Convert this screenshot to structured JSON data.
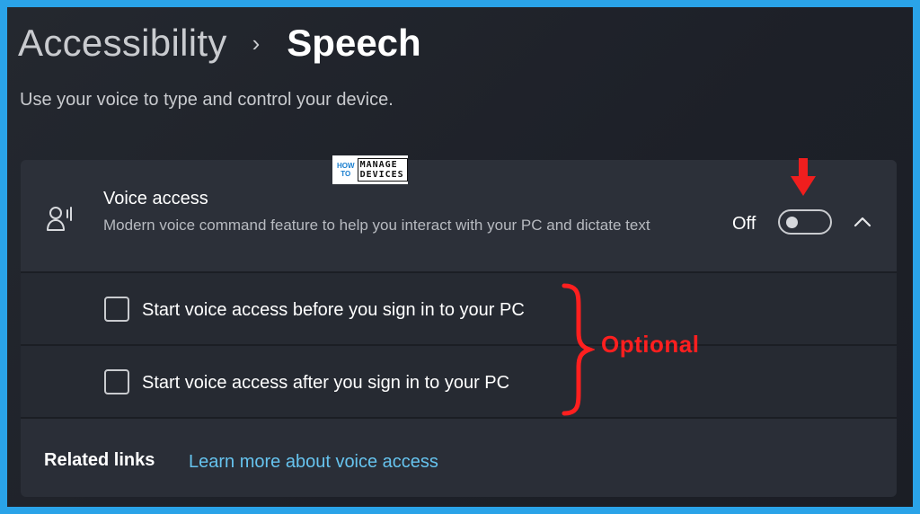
{
  "breadcrumb": {
    "parent": "Accessibility",
    "separator": "›",
    "current": "Speech"
  },
  "subtitle": "Use your voice to type and control your device.",
  "voice_access": {
    "icon": "voice-access-icon",
    "title": "Voice access",
    "description": "Modern voice command feature to help you interact with your PC and dictate text",
    "toggle_state_label": "Off",
    "toggle_on": false,
    "expanded": true
  },
  "options": [
    {
      "label": "Start voice access before you sign in to your PC",
      "checked": false
    },
    {
      "label": "Start voice access after you sign in to your PC",
      "checked": false
    }
  ],
  "related": {
    "title": "Related links",
    "link": "Learn more about voice access"
  },
  "watermark": {
    "line1": "HOW TO",
    "line2": "MANAGE DEVICES"
  },
  "annotation": {
    "label": "Optional",
    "color": "#ff1f1f"
  },
  "colors": {
    "accent_link": "#66c3ee",
    "frame_border": "#2aa3e8"
  }
}
